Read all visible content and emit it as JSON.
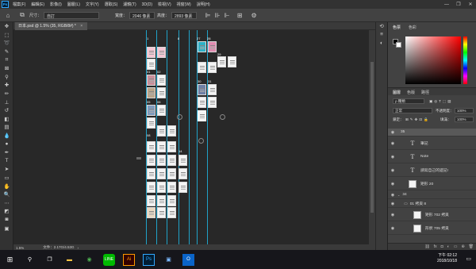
{
  "menubar": {
    "app_icon": "Ps",
    "items": [
      "檔案(F)",
      "編輯(E)",
      "影像(I)",
      "圖層(L)",
      "文字(Y)",
      "選取(S)",
      "濾鏡(T)",
      "3D(D)",
      "檢視(V)",
      "視窗(W)",
      "說明(H)"
    ]
  },
  "options": {
    "size_label": "尺寸：",
    "size_value": "自訂",
    "width_label": "寬度：",
    "width_value": "2046 像素",
    "height_label": "高度：",
    "height_value": "2893 像素"
  },
  "document": {
    "tab_title": "日本.psd @ 1.5% (35, RGB/8#) *",
    "close_glyph": "×"
  },
  "canvas": {
    "page_labels": [
      "1",
      "8",
      "27",
      "28",
      "01",
      "02",
      "05",
      "06",
      "29",
      "30",
      "31",
      "32",
      "08",
      "09",
      "14"
    ]
  },
  "status": {
    "zoom": "1.5%",
    "doc_info": "文件：2.17G/4.53G"
  },
  "panels": {
    "color_tabs": [
      "色票",
      "色彩"
    ],
    "layer_tabs": [
      "圖層",
      "色版",
      "路徑"
    ],
    "filter_label": "ρ 種類",
    "blend_mode": "正常",
    "opacity_label": "不透明度：",
    "opacity_value": "100%",
    "lock_label": "鎖定：",
    "fill_label": "填滿：",
    "fill_value": "100%"
  },
  "layers": [
    {
      "name": "35",
      "kind": "group",
      "selected": true
    },
    {
      "name": "筆記",
      "kind": "text"
    },
    {
      "name": "Note",
      "kind": "text"
    },
    {
      "name": "請寫自己的遊記!",
      "kind": "text"
    },
    {
      "name": "矩形 20",
      "kind": "image"
    },
    {
      "name": "34",
      "kind": "group"
    },
    {
      "name": "01 拷貝 8",
      "kind": "group"
    },
    {
      "name": "矩形 702 拷貝",
      "kind": "image"
    },
    {
      "name": "形狀 705 拷貝",
      "kind": "image"
    }
  ],
  "taskbar": {
    "time": "下午 02:12",
    "date": "2018/10/18"
  }
}
